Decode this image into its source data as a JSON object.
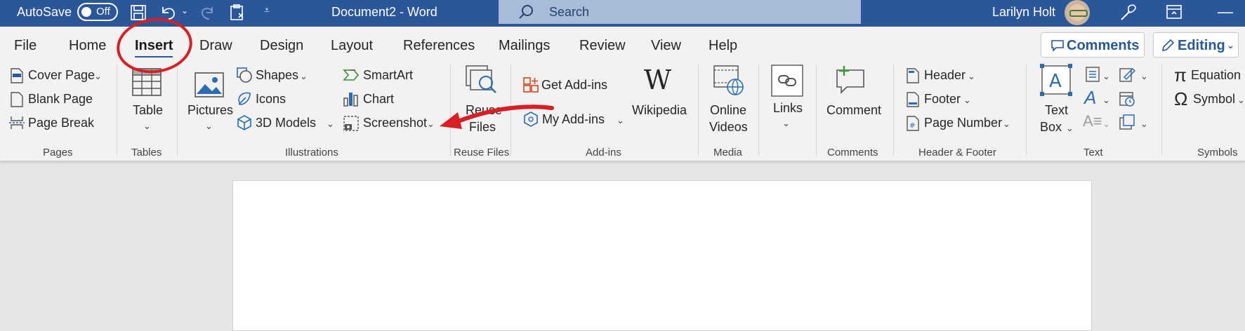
{
  "titlebar": {
    "autosave_label": "AutoSave",
    "autosave_state": "Off",
    "document_title": "Document2  -  Word",
    "search_placeholder": "Search",
    "user_name": "Larilyn Holt"
  },
  "tabs": [
    "File",
    "Home",
    "Insert",
    "Draw",
    "Design",
    "Layout",
    "References",
    "Mailings",
    "Review",
    "View",
    "Help"
  ],
  "active_tab": "Insert",
  "actions": {
    "comments": "Comments",
    "editing": "Editing"
  },
  "ribbon": {
    "pages": {
      "cover_page": "Cover Page",
      "blank_page": "Blank Page",
      "page_break": "Page Break",
      "group": "Pages"
    },
    "tables": {
      "table": "Table",
      "group": "Tables"
    },
    "illustrations": {
      "pictures": "Pictures",
      "shapes": "Shapes",
      "icons": "Icons",
      "models_3d": "3D Models",
      "smartart": "SmartArt",
      "chart": "Chart",
      "screenshot": "Screenshot",
      "group": "Illustrations"
    },
    "reuse": {
      "reuse_line1": "Reuse",
      "reuse_line2": "Files",
      "group": "Reuse Files"
    },
    "addins": {
      "get_addins": "Get Add-ins",
      "my_addins": "My Add-ins",
      "wikipedia": "Wikipedia",
      "group": "Add-ins"
    },
    "media": {
      "online_line1": "Online",
      "online_line2": "Videos",
      "group": "Media"
    },
    "links": {
      "links": "Links"
    },
    "comments": {
      "comment": "Comment",
      "group": "Comments"
    },
    "header_footer": {
      "header": "Header",
      "footer": "Footer",
      "page_number": "Page Number",
      "group": "Header & Footer"
    },
    "text": {
      "textbox_line1": "Text",
      "textbox_line2": "Box",
      "group": "Text"
    },
    "symbols": {
      "equation": "Equation",
      "symbol": "Symbol",
      "group": "Symbols"
    }
  },
  "colors": {
    "brand": "#2b579a",
    "annotation": "#d81f26"
  }
}
